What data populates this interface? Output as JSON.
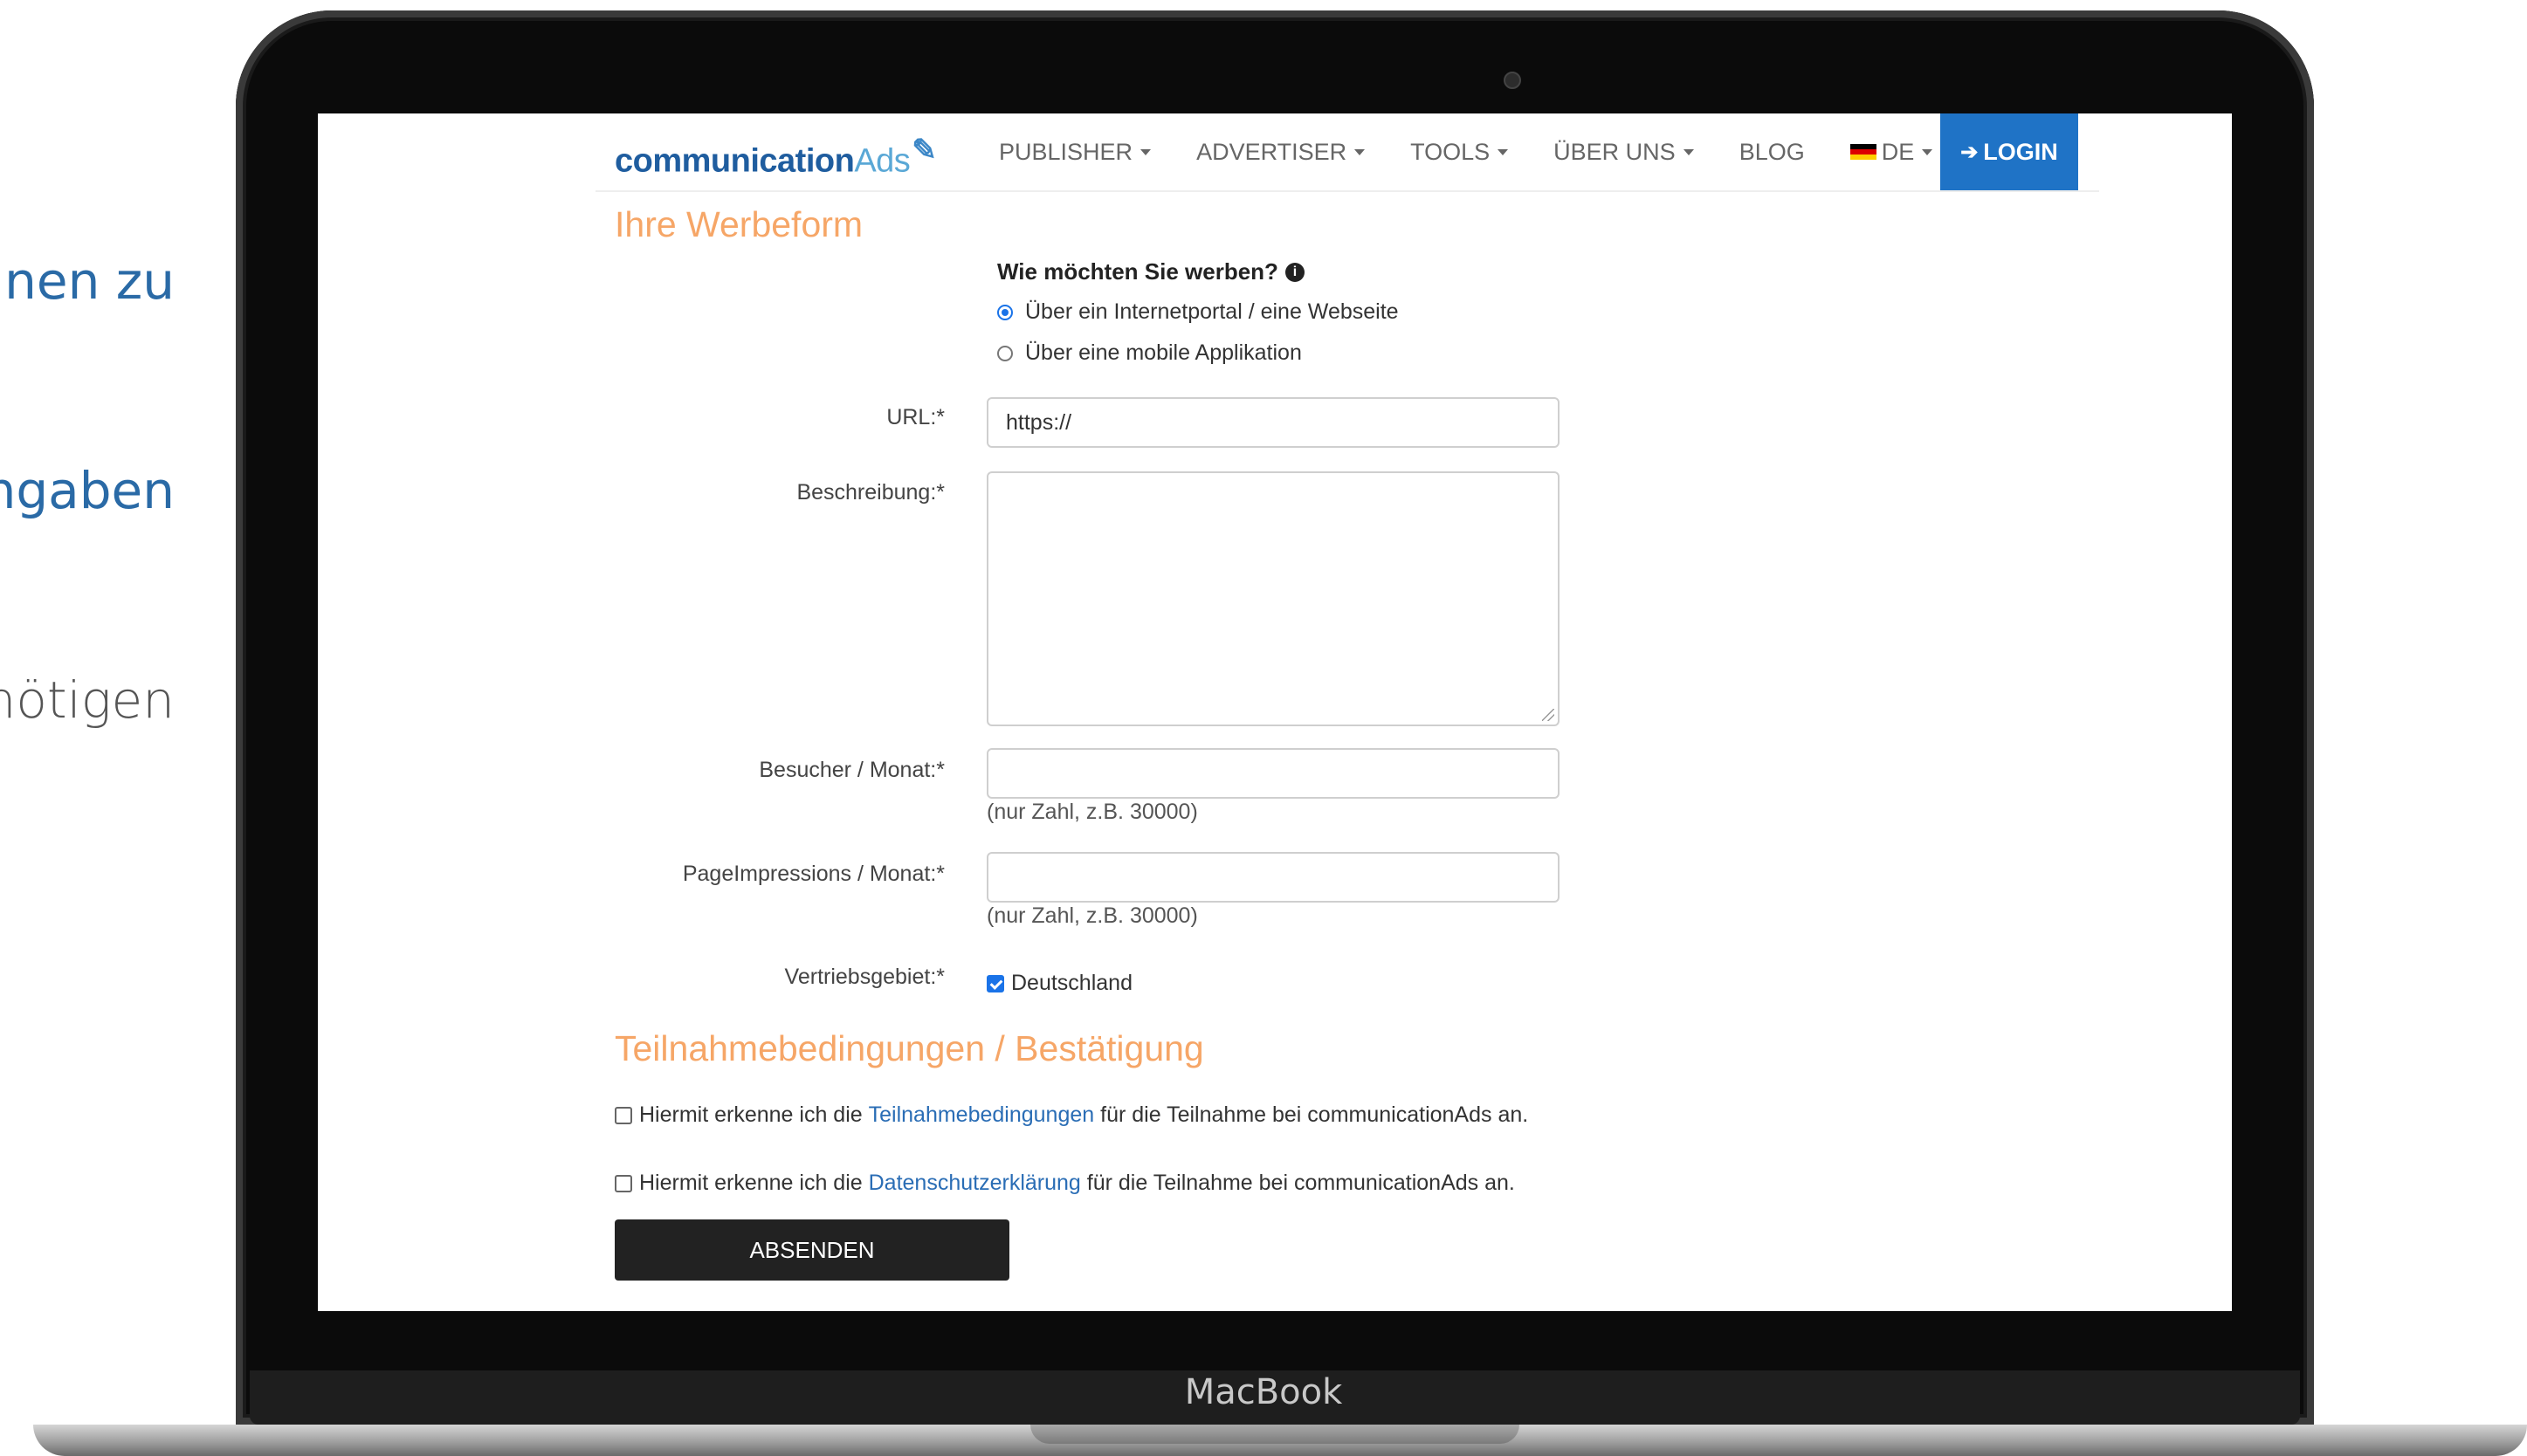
{
  "side_texts": [
    "nen  zu",
    "ngaben",
    "nötigen"
  ],
  "device": {
    "label": "MacBook"
  },
  "navbar": {
    "logo_part1": "communication",
    "logo_part2": "Ads",
    "items": [
      {
        "label": "PUBLISHER",
        "dropdown": true
      },
      {
        "label": "ADVERTISER",
        "dropdown": true
      },
      {
        "label": "TOOLS",
        "dropdown": true
      },
      {
        "label": "ÜBER UNS",
        "dropdown": true
      },
      {
        "label": "BLOG",
        "dropdown": false
      }
    ],
    "language": "DE",
    "login_label": "LOGIN",
    "login_color": "#1f73c6"
  },
  "form": {
    "section_title": "Ihre Werbeform",
    "question": "Wie möchten Sie werben?",
    "radio_options": [
      {
        "label": "Über ein Internetportal / eine Webseite",
        "checked": true
      },
      {
        "label": "Über eine mobile Applikation",
        "checked": false
      }
    ],
    "url_label": "URL:*",
    "url_value": "https://",
    "beschreibung_label": "Beschreibung:*",
    "beschreibung_value": "",
    "besucher_label": "Besucher / Monat:*",
    "besucher_hint": "(nur Zahl, z.B. 30000)",
    "pi_label": "PageImpressions / Monat:*",
    "pi_hint": "(nur Zahl, z.B. 30000)",
    "vertrieb_label": "Vertriebsgebiet:*",
    "vertrieb_option": "Deutschland",
    "vertrieb_checked": true
  },
  "terms": {
    "section_title": "Teilnahmebedingungen / Bestätigung",
    "tn_prefix": "Hiermit erkenne ich die ",
    "tn_link": "Teilnahmebedingungen",
    "tn_suffix": " für die Teilnahme bei communicationAds an.",
    "ds_prefix": "Hiermit erkenne ich die ",
    "ds_link": "Datenschutzerklärung",
    "ds_suffix": " für die Teilnahme bei communicationAds an.",
    "submit_label": "ABSENDEN"
  },
  "colors": {
    "accent_orange": "#f6a667",
    "link_blue": "#2a6db5",
    "button_dark": "#222222"
  }
}
